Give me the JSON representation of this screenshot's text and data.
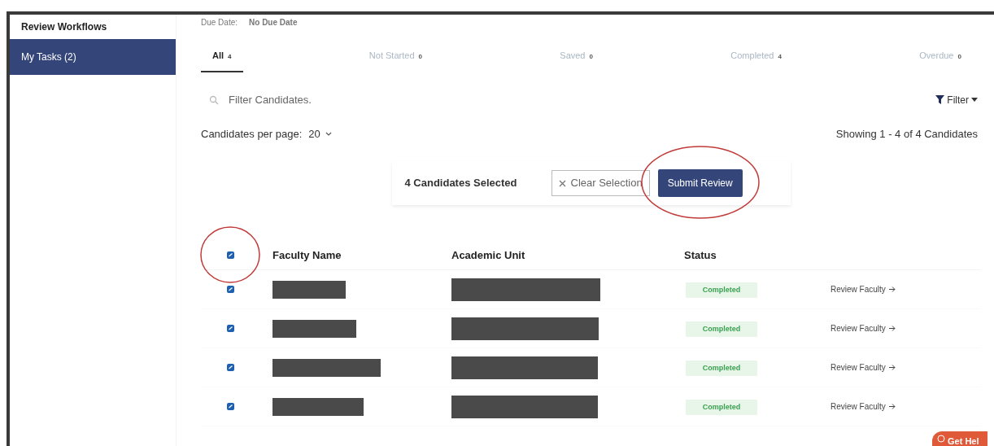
{
  "sidebar": {
    "items": [
      {
        "label": "Review Workflows",
        "selected": false
      },
      {
        "label": "My Tasks (2)",
        "selected": true
      }
    ]
  },
  "due_date": {
    "label": "Due Date:",
    "value": "No Due Date"
  },
  "tabs": [
    {
      "label": "All",
      "count": "4",
      "selected": true
    },
    {
      "label": "Not Started",
      "count": "0",
      "selected": false
    },
    {
      "label": "Saved",
      "count": "0",
      "selected": false
    },
    {
      "label": "Completed",
      "count": "4",
      "selected": false
    },
    {
      "label": "Overdue",
      "count": "0",
      "selected": false
    }
  ],
  "search": {
    "placeholder": "Filter Candidates."
  },
  "filter_button": "Filter",
  "per_page": {
    "label": "Candidates per page:",
    "value": "20"
  },
  "showing": "Showing 1 - 4 of 4 Candidates",
  "selection_bar": {
    "text": "4 Candidates Selected",
    "clear_button": "Clear Selection",
    "submit_button": "Submit Review"
  },
  "table": {
    "select_all_checked": true,
    "columns": [
      "Faculty Name",
      "Academic Unit",
      "Status"
    ],
    "rows": [
      {
        "checked": true,
        "status": "Completed",
        "action": "Review Faculty"
      },
      {
        "checked": true,
        "status": "Completed",
        "action": "Review Faculty"
      },
      {
        "checked": true,
        "status": "Completed",
        "action": "Review Faculty"
      },
      {
        "checked": true,
        "status": "Completed",
        "action": "Review Faculty"
      }
    ]
  },
  "help_button": "Get Hel"
}
